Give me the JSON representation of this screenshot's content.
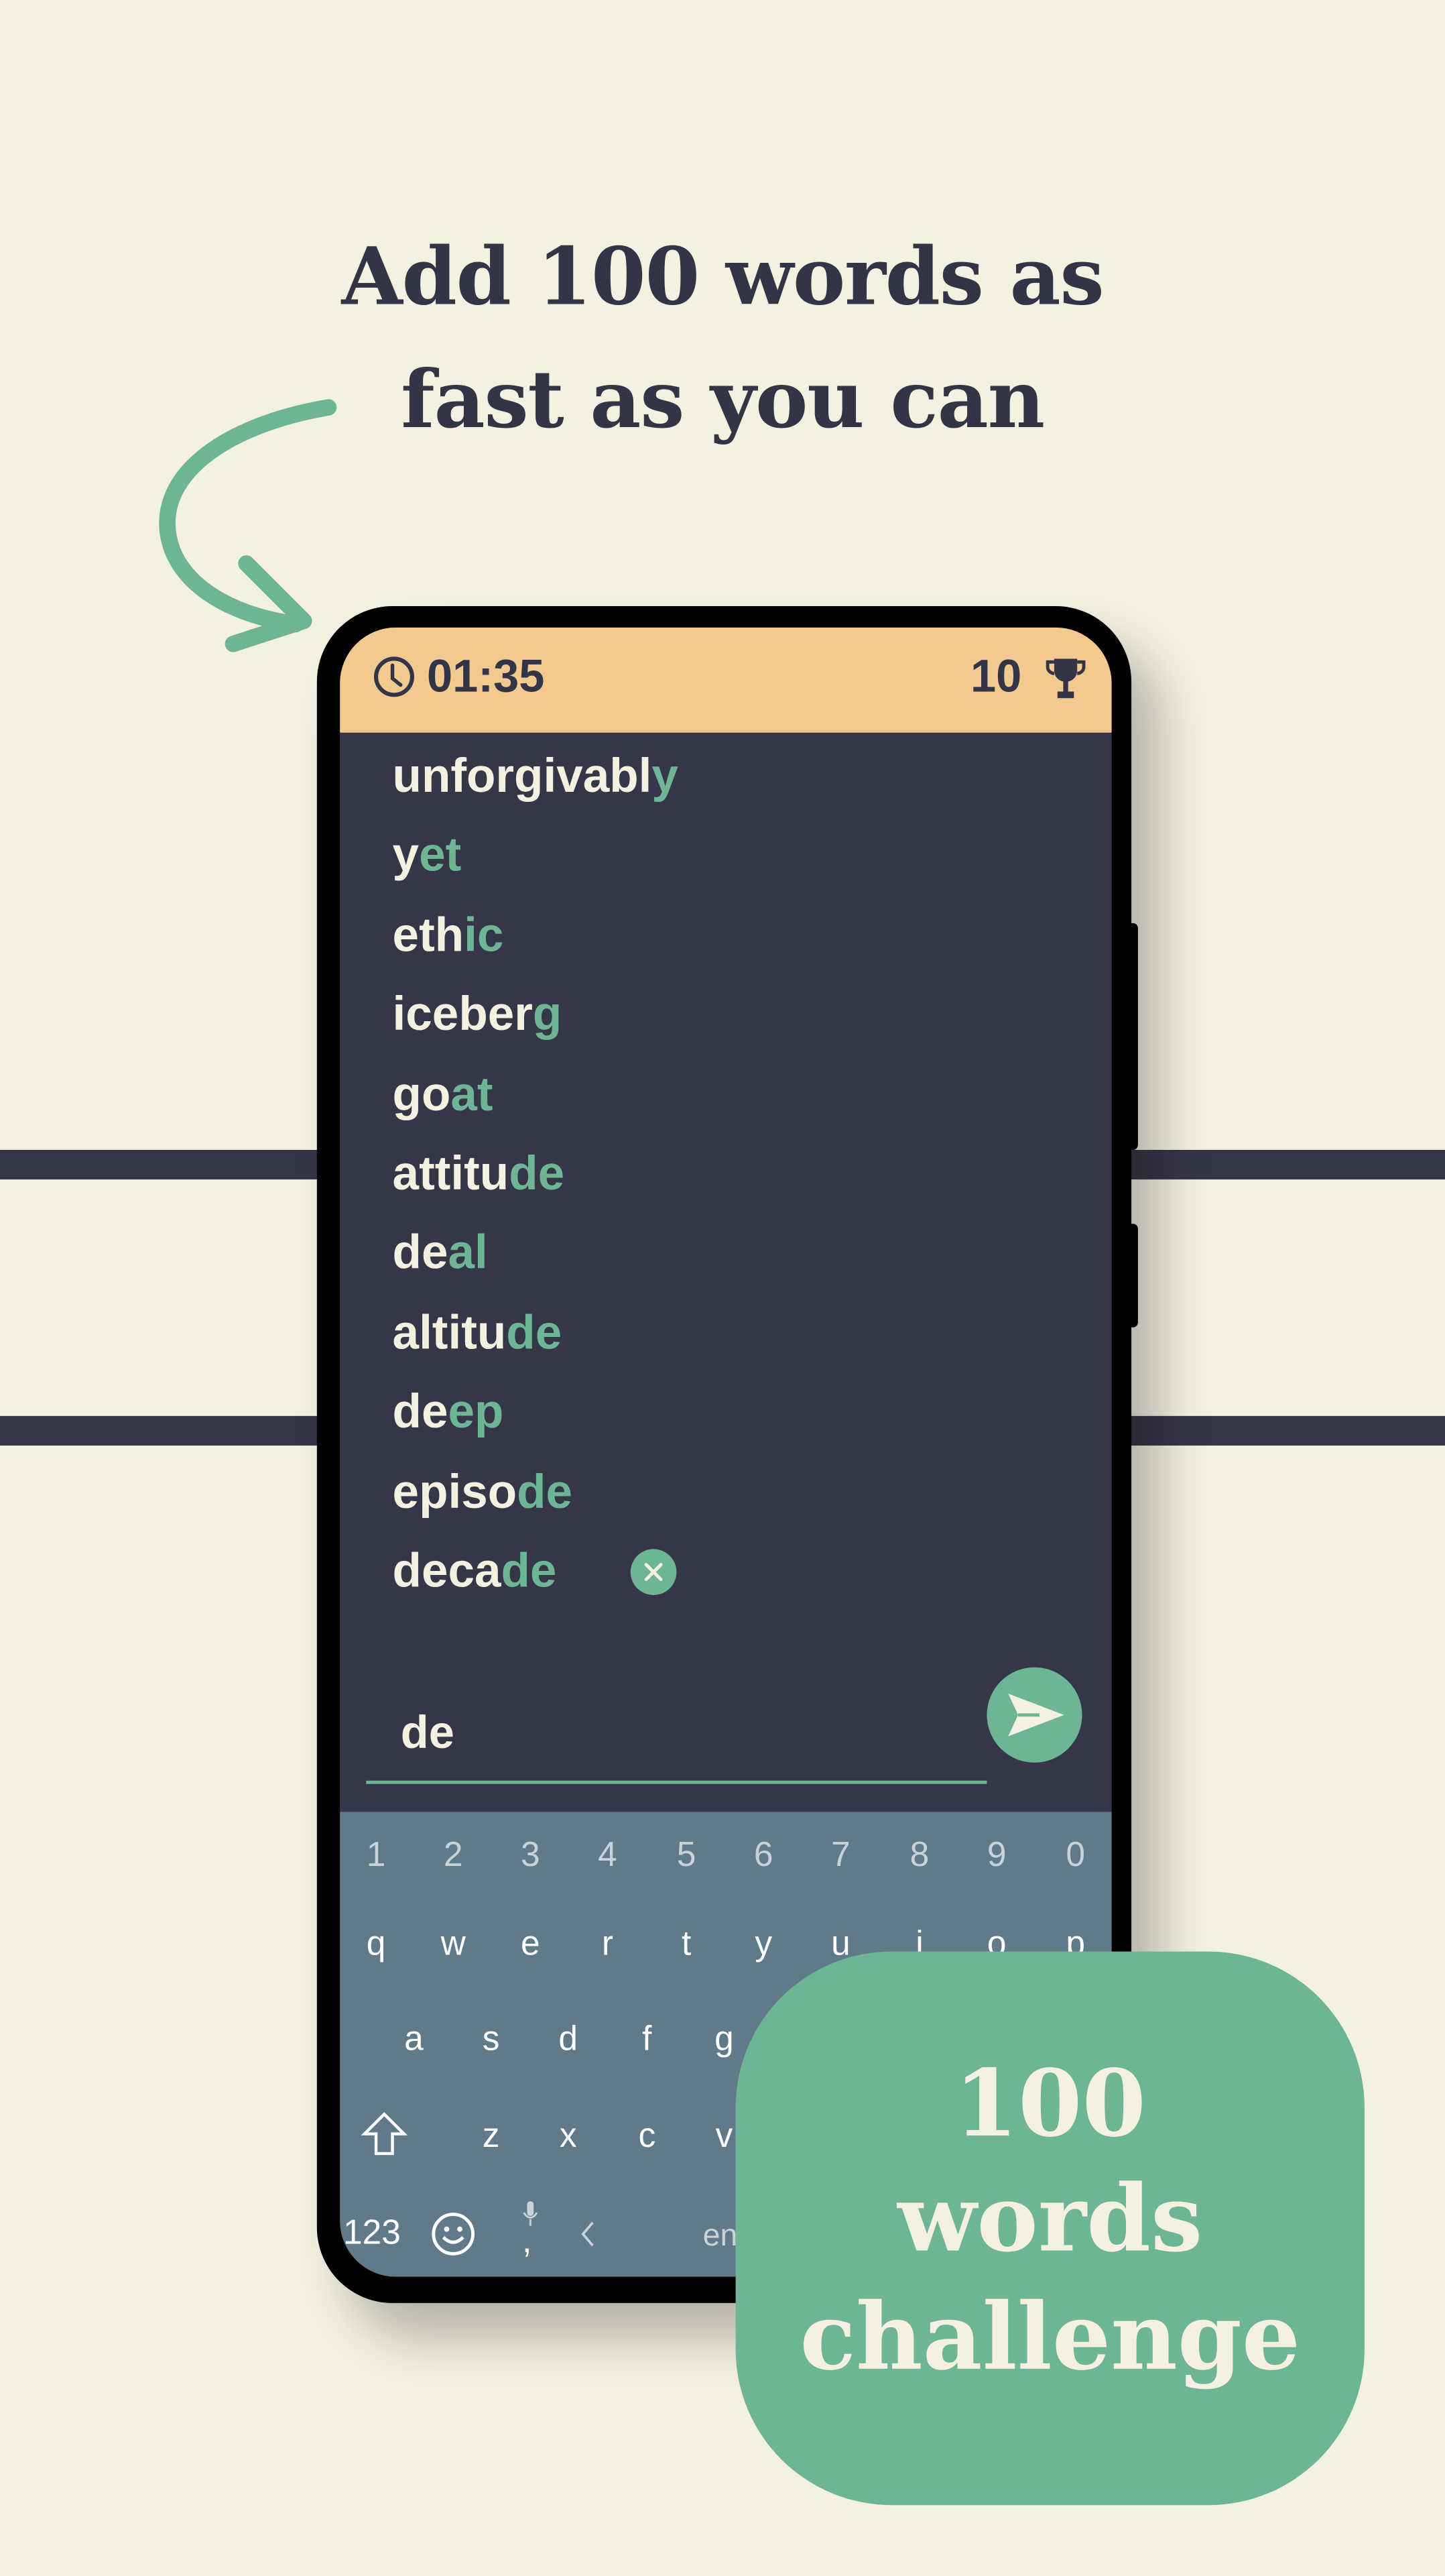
{
  "headline": {
    "line1": "Add 100 words as",
    "line2": "fast as you can"
  },
  "header": {
    "timer": "01:35",
    "score": "10",
    "timer_icon": "clock-icon",
    "score_icon": "trophy-icon"
  },
  "words": [
    {
      "base": "unforgivabl",
      "suffix": "y"
    },
    {
      "base": "y",
      "suffix": "et"
    },
    {
      "base": "eth",
      "suffix": "ic"
    },
    {
      "base": "iceber",
      "suffix": "g"
    },
    {
      "base": "go",
      "suffix": "at"
    },
    {
      "base": "attitu",
      "suffix": "de"
    },
    {
      "base": "de",
      "suffix": "al"
    },
    {
      "base": "altitu",
      "suffix": "de"
    },
    {
      "base": "de",
      "suffix": "ep"
    },
    {
      "base": "episo",
      "suffix": "de"
    },
    {
      "base": "deca",
      "suffix": "de"
    }
  ],
  "input": {
    "value": "de"
  },
  "keyboard": {
    "numbers": [
      "1",
      "2",
      "3",
      "4",
      "5",
      "6",
      "7",
      "8",
      "9",
      "0"
    ],
    "row1": [
      "q",
      "w",
      "e",
      "r",
      "t",
      "y",
      "u",
      "i",
      "o",
      "p"
    ],
    "row2": [
      "a",
      "s",
      "d",
      "f",
      "g"
    ],
    "row3": [
      "z",
      "x",
      "c",
      "v"
    ],
    "bottom": {
      "numbers_key": "123",
      "comma": ",",
      "space_label": "en"
    }
  },
  "badge": {
    "line1": "100",
    "line2": "words",
    "line3": "challenge"
  },
  "colors": {
    "background": "#f3f1e0",
    "dark": "#363649",
    "accent": "#6db595",
    "header": "#f2c98f",
    "keyboard": "#607a89"
  }
}
